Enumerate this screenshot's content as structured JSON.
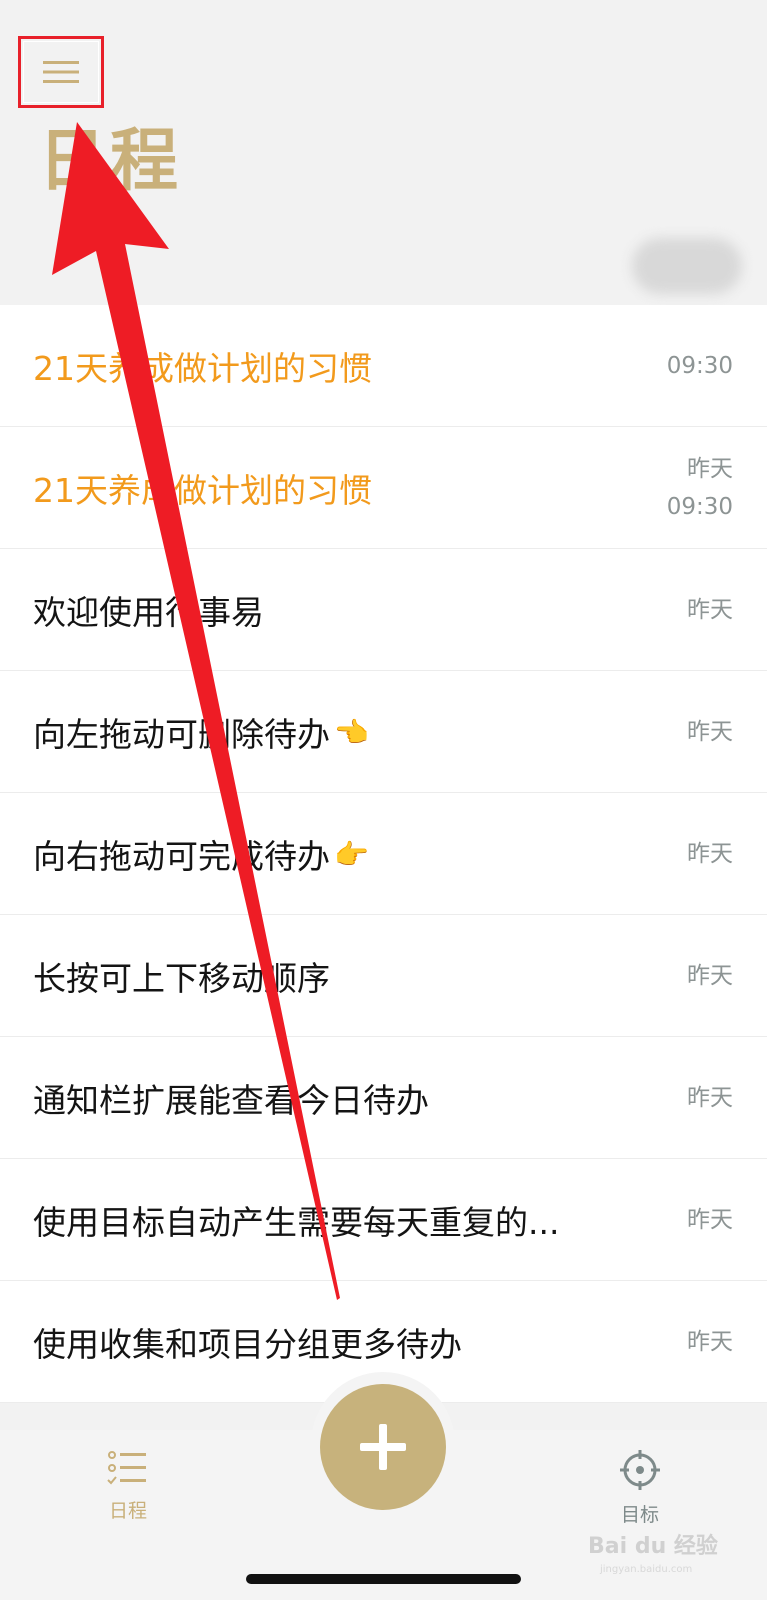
{
  "header": {
    "title": "日程"
  },
  "items": [
    {
      "title": "21天养成做计划的习惯",
      "time": [
        "09:30"
      ],
      "highlight": true
    },
    {
      "title": "21天养成做计划的习惯",
      "time": [
        "昨天",
        "09:30"
      ],
      "highlight": true
    },
    {
      "title": "欢迎使用行事易",
      "time": [
        "昨天"
      ],
      "highlight": false
    },
    {
      "title": "向左拖动可删除待办",
      "emoji": "👈",
      "time": [
        "昨天"
      ],
      "highlight": false
    },
    {
      "title": "向右拖动可完成待办",
      "emoji": "👉",
      "time": [
        "昨天"
      ],
      "highlight": false
    },
    {
      "title": "长按可上下移动顺序",
      "time": [
        "昨天"
      ],
      "highlight": false
    },
    {
      "title": "通知栏扩展能查看今日待办",
      "time": [
        "昨天"
      ],
      "highlight": false
    },
    {
      "title": "使用目标自动产生需要每天重复的...",
      "time": [
        "昨天"
      ],
      "highlight": false
    },
    {
      "title": "使用收集和项目分组更多待办",
      "time": [
        "昨天"
      ],
      "highlight": false
    }
  ],
  "tabbar": {
    "schedule_label": "日程",
    "goal_label": "目标"
  },
  "watermark": {
    "text": "Bai du 经验",
    "sub": "jingyan.baidu.com"
  },
  "colors": {
    "accent": "#c9b07a",
    "highlight_text": "#f29a1c",
    "annotation_red": "#e8202a"
  },
  "icons": {
    "menu": "hamburger-menu-icon",
    "schedule": "list-icon",
    "goal": "crosshair-target-icon",
    "add": "plus-icon"
  }
}
